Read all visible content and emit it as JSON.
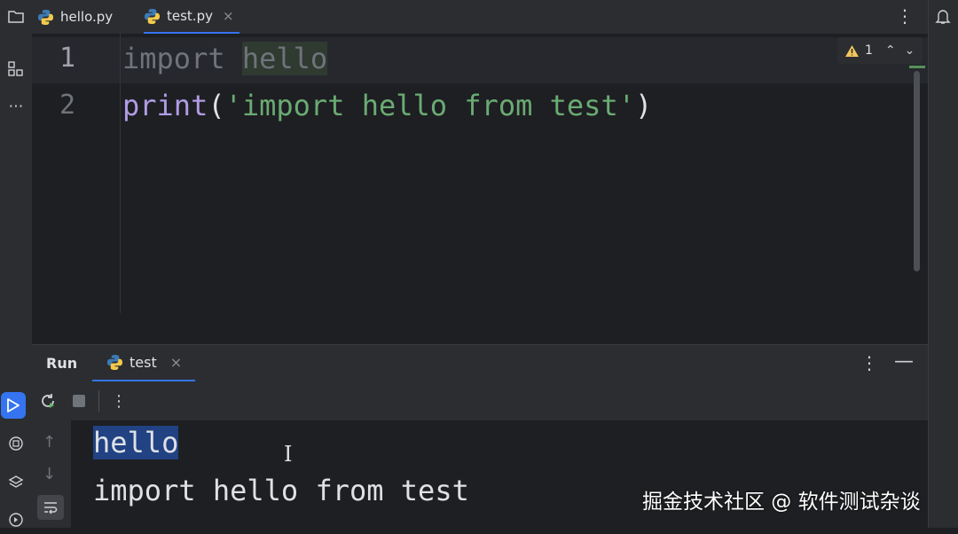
{
  "tabs": [
    {
      "label": "hello.py",
      "active": false
    },
    {
      "label": "test.py",
      "active": true,
      "close": "×"
    }
  ],
  "editor": {
    "lines": [
      {
        "number": "1",
        "tokens": {
          "keyword": "import",
          "module": "hello"
        }
      },
      {
        "number": "2",
        "tokens": {
          "func": "print",
          "open": "(",
          "string": "'import hello from test'",
          "close": ")"
        }
      }
    ],
    "inspection_count": "1"
  },
  "run_panel": {
    "title": "Run",
    "tab_label": "test",
    "tab_close": "×",
    "output": [
      "hello",
      "import hello from test"
    ]
  },
  "colors": {
    "accent": "#3574f0",
    "string": "#6aab73",
    "function": "#b09ce6",
    "selection": "#214283",
    "warning": "#f2c55c"
  },
  "watermark": "掘金技术社区 @ 软件测试杂谈"
}
